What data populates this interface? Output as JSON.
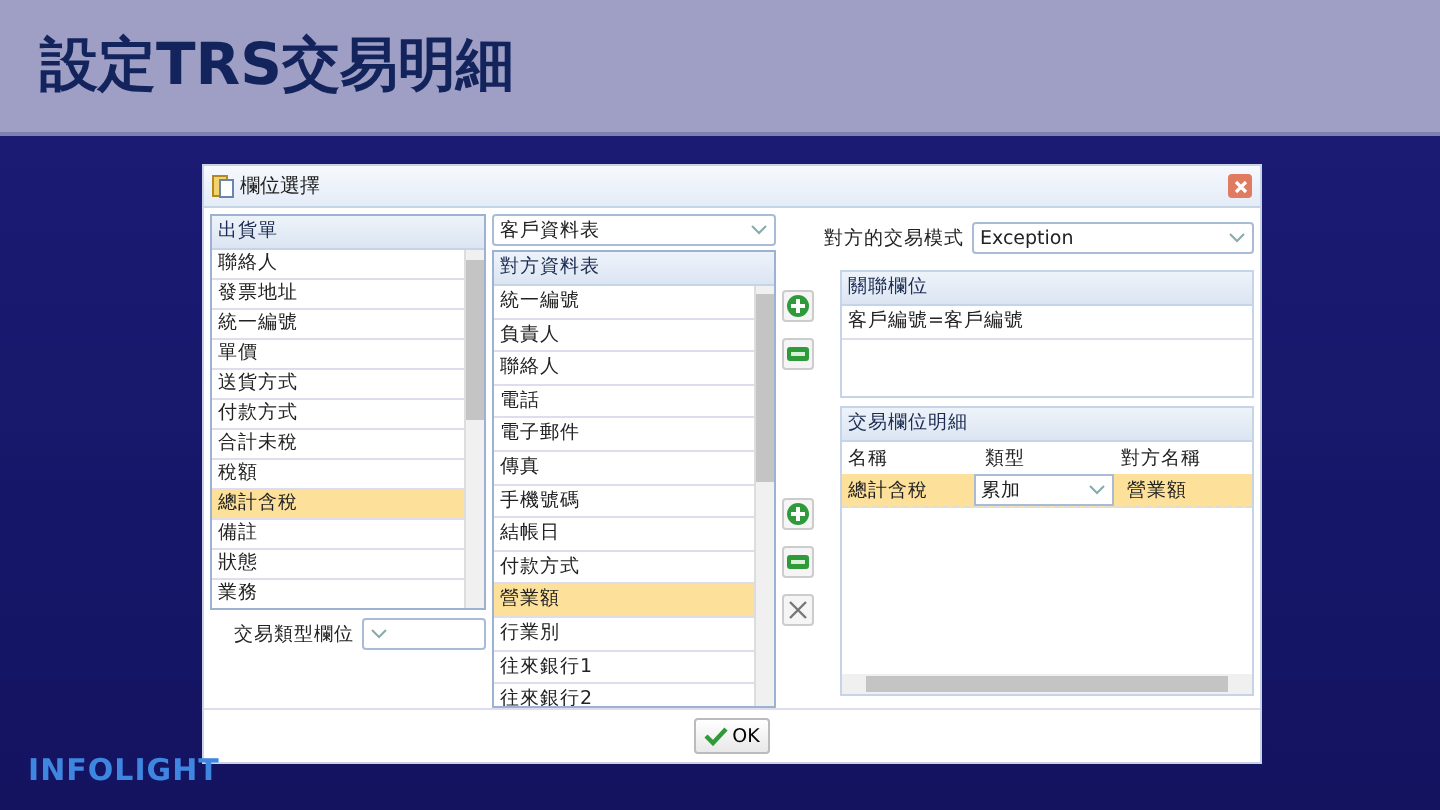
{
  "slide_title": "設定TRS交易明細",
  "dialog": {
    "title": "欄位選擇",
    "source_list": {
      "header": "出貨單",
      "items": [
        {
          "label": "聯絡人",
          "selected": false
        },
        {
          "label": "發票地址",
          "selected": false
        },
        {
          "label": "統一編號",
          "selected": false
        },
        {
          "label": "單價",
          "selected": false
        },
        {
          "label": "送貨方式",
          "selected": false
        },
        {
          "label": "付款方式",
          "selected": false
        },
        {
          "label": "合計未稅",
          "selected": false
        },
        {
          "label": "稅額",
          "selected": false
        },
        {
          "label": "總計含稅",
          "selected": true
        },
        {
          "label": "備註",
          "selected": false
        },
        {
          "label": "狀態",
          "selected": false
        },
        {
          "label": "業務",
          "selected": false
        }
      ]
    },
    "source_field": {
      "label": "交易類型欄位"
    },
    "target_table": {
      "value": "客戶資料表"
    },
    "target_list": {
      "header": "對方資料表",
      "items": [
        {
          "label": "統一編號",
          "selected": false
        },
        {
          "label": "負責人",
          "selected": false
        },
        {
          "label": "聯絡人",
          "selected": false
        },
        {
          "label": "電話",
          "selected": false
        },
        {
          "label": "電子郵件",
          "selected": false
        },
        {
          "label": "傳真",
          "selected": false
        },
        {
          "label": "手機號碼",
          "selected": false
        },
        {
          "label": "結帳日",
          "selected": false
        },
        {
          "label": "付款方式",
          "selected": false
        },
        {
          "label": "營業額",
          "selected": true
        },
        {
          "label": "行業別",
          "selected": false
        },
        {
          "label": "往來銀行1",
          "selected": false
        },
        {
          "label": "往來銀行2",
          "selected": false
        }
      ]
    },
    "mode": {
      "label": "對方的交易模式",
      "value": "Exception"
    },
    "relation": {
      "header": "關聯欄位",
      "rows": [
        "客戶編號=客戶編號"
      ]
    },
    "details": {
      "header": "交易欄位明細",
      "columns": [
        "名稱",
        "類型",
        "對方名稱"
      ],
      "rows": [
        {
          "name": "總計含稅",
          "type": "累加",
          "target": "營業額",
          "selected": true
        }
      ]
    },
    "ok_button": "OK"
  },
  "logo": "INFOLIGHT"
}
